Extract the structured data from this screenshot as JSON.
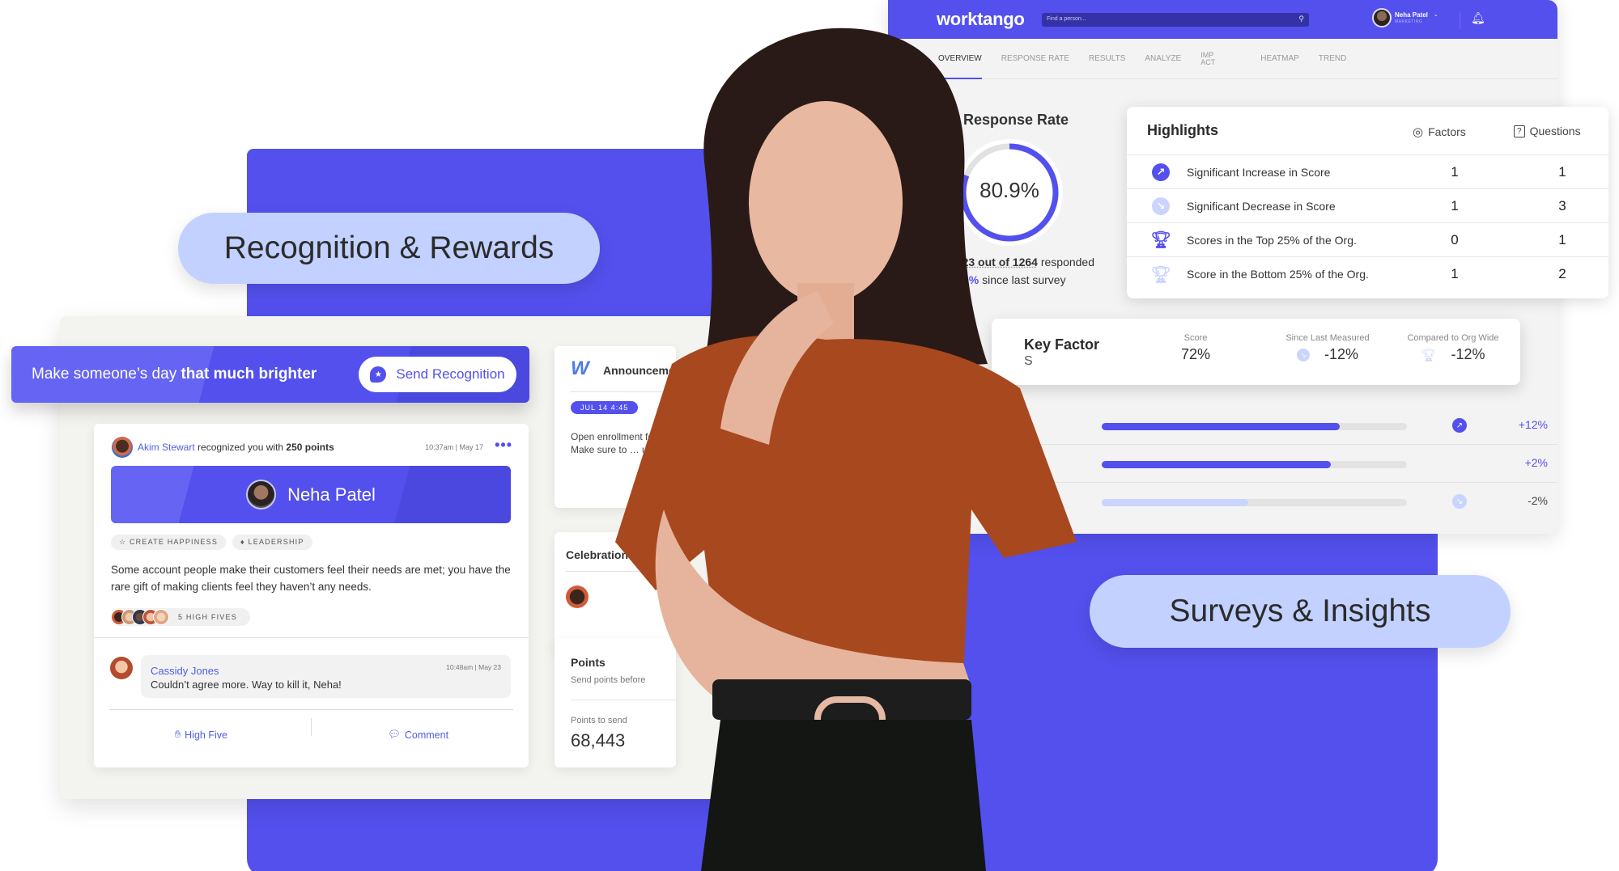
{
  "colors": {
    "brand": "#5350ee",
    "pill": "#c2d1ff",
    "accent_light": "#c9d5ff"
  },
  "pills": {
    "recognition": "Recognition & Rewards",
    "surveys": "Surveys & Insights"
  },
  "survey": {
    "logo": "worktango",
    "search_placeholder": "Find a person...",
    "user": {
      "name": "Neha Patel",
      "department": "MARKETING"
    },
    "tabs": [
      {
        "label": "OVERVIEW",
        "active": true
      },
      {
        "label": "RESPONSE RATE"
      },
      {
        "label": "RESULTS"
      },
      {
        "label": "ANALYZE"
      },
      {
        "label": "IMP ACT"
      },
      {
        "label": "HEATMAP"
      },
      {
        "label": "TREND"
      }
    ],
    "response_rate": {
      "title": "Response Rate",
      "value_pct": 80.9,
      "value_label": "80.9%",
      "responded": "1023 out of 1264",
      "responded_suffix": "responded",
      "change": "+10%",
      "change_suffix": "since last survey"
    },
    "highlights": {
      "title": "Highlights",
      "col_factors": "Factors",
      "col_questions": "Questions",
      "rows": [
        {
          "label": "Significant Increase in Score",
          "factors": "1",
          "questions": "1",
          "icon": "trend-up-icon"
        },
        {
          "label": "Significant Decrease in Score",
          "factors": "1",
          "questions": "3",
          "icon": "trend-down-icon"
        },
        {
          "label": "Scores in the Top 25% of the Org.",
          "factors": "0",
          "questions": "1",
          "icon": "trophy-icon"
        },
        {
          "label": "Score in the Bottom 25% of the Org.",
          "factors": "1",
          "questions": "2",
          "icon": "trophy-light-icon"
        }
      ]
    },
    "key_factor": {
      "title": "Key Factor",
      "subtitle": "S",
      "score_label": "Score",
      "score": "72%",
      "since_label": "Since Last Measured",
      "since": "-12%",
      "org_label": "Compared to Org Wide",
      "org": "-12%"
    },
    "bars": [
      {
        "fill_pct": 78,
        "delta": "+12%",
        "trend": "up"
      },
      {
        "fill_pct": 75,
        "delta": "+2%",
        "trend": "none"
      },
      {
        "fill_pct": 48,
        "delta": "-2%",
        "trend": "down"
      }
    ]
  },
  "recognition": {
    "banner_text": "Make someone’s day ",
    "banner_bold": "that much brighter",
    "send_button": "Send Recognition",
    "post": {
      "giver": "Akim Stewart",
      "action": " recognized you with ",
      "points": "250 points",
      "time": "10:37am | May 17",
      "recipient": "Neha Patel",
      "tags": [
        "CREATE HAPPINESS",
        "LEADERSHIP"
      ],
      "message": "Some account people make their customers feel their needs are met; you have the rare gift of making clients feel they haven’t any needs.",
      "high_fives": "5 HIGH FIVES",
      "comment": {
        "name": "Cassidy Jones",
        "time": "10:48am | May 23",
        "text": "Couldn’t agree more. Way to kill it, Neha!"
      },
      "actions": {
        "high_five": "High Five",
        "comment": "Comment"
      }
    },
    "announcement": {
      "title": "Announcements",
      "date": "JUL 14 4:45",
      "text": "Open enrollment for insurance … Make sure to … update … Incentive"
    },
    "celebrations": {
      "title": "Celebrations"
    },
    "points": {
      "title": "Points",
      "subtitle": "Send points before",
      "label": "Points to send",
      "value": "68,443"
    }
  }
}
